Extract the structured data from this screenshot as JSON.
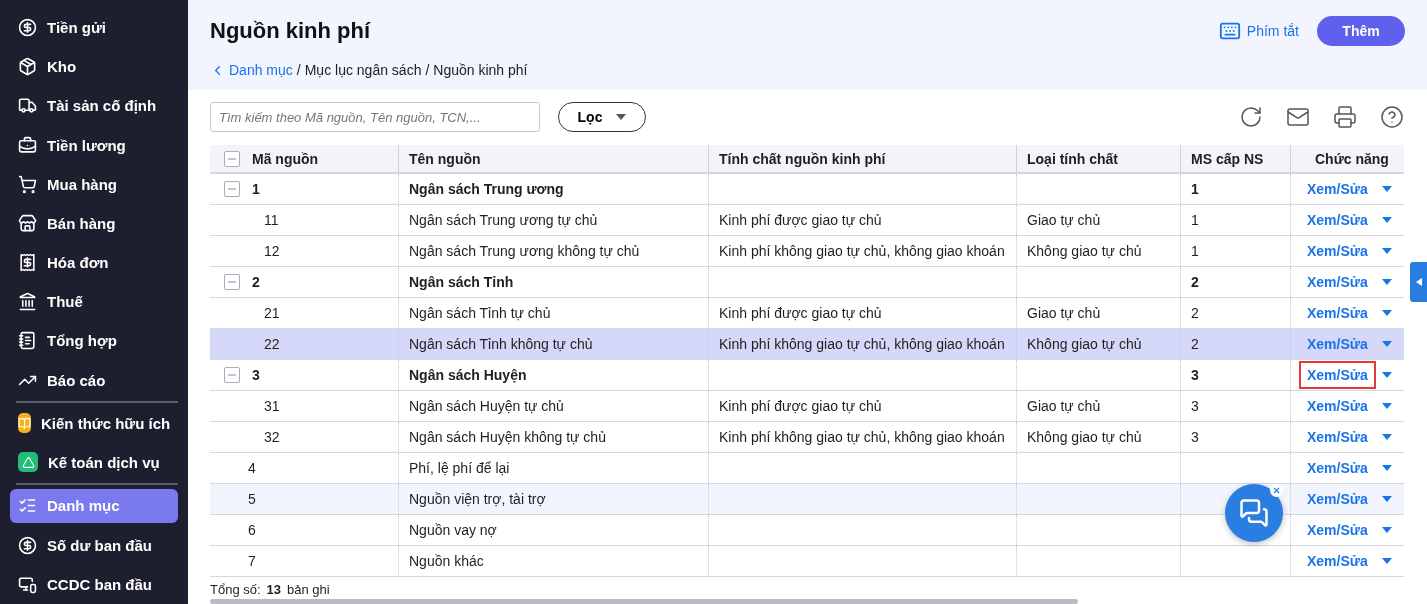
{
  "sidebar": {
    "groups": [
      [
        {
          "label": "Tiền gửi",
          "selected": false
        },
        {
          "label": "Kho",
          "selected": false
        },
        {
          "label": "Tài sản cố định",
          "selected": false
        },
        {
          "label": "Tiền lương",
          "selected": false
        },
        {
          "label": "Mua hàng",
          "selected": false
        },
        {
          "label": "Bán hàng",
          "selected": false
        },
        {
          "label": "Hóa đơn",
          "selected": false
        },
        {
          "label": "Thuế",
          "selected": false
        },
        {
          "label": "Tổng hợp",
          "selected": false
        },
        {
          "label": "Báo cáo",
          "selected": false
        }
      ],
      [
        {
          "label": "Kiến thức hữu ích",
          "selected": false,
          "color": "#f5b31b"
        },
        {
          "label": "Kế toán dịch vụ",
          "selected": false,
          "color": "#1fbf7a"
        }
      ],
      [
        {
          "label": "Danh mục",
          "selected": true
        },
        {
          "label": "Số dư ban đầu",
          "selected": false
        },
        {
          "label": "CCDC ban đầu",
          "selected": false
        }
      ]
    ]
  },
  "header": {
    "title": "Nguồn kinh phí",
    "breadcrumb": [
      {
        "kind": "link",
        "label": "Danh mục"
      },
      {
        "kind": "separator",
        "label": "/"
      },
      {
        "kind": "text",
        "label": "Mục lục ngân sách"
      },
      {
        "kind": "separator",
        "label": "/"
      },
      {
        "kind": "text",
        "label": "Nguồn kinh phí"
      }
    ],
    "shortcut": "Phím tắt",
    "add_button": "Thêm"
  },
  "toolbar": {
    "search": {
      "placeholder": "Tìm kiếm theo Mã nguồn, Tên nguồn, TCN,..."
    },
    "filter": "Lọc"
  },
  "table": {
    "expand_all": true,
    "columns": [
      "Mã nguồn",
      "Tên nguồn",
      "Tính chất nguồn kinh phí",
      "Loại tính chất",
      "MS cấp NS",
      "Chức năng"
    ],
    "rows": [
      {
        "kind": "group",
        "expanded": true,
        "selected": false,
        "hovered": false,
        "outlined": false,
        "cells": [
          "1",
          "Ngân sách Trung ương",
          "",
          "",
          "1"
        ],
        "action": "Xem/Sửa"
      },
      {
        "kind": "child",
        "selected": false,
        "hovered": false,
        "outlined": false,
        "cells": [
          "11",
          "Ngân sách Trung ương tự chủ",
          "Kinh phí được giao tự chủ",
          "Giao tự chủ",
          "1"
        ],
        "action": "Xem/Sửa"
      },
      {
        "kind": "child",
        "selected": false,
        "hovered": false,
        "outlined": false,
        "cells": [
          "12",
          "Ngân sách Trung ương không tự chủ",
          "Kinh phí không giao tự chủ, không giao khoán",
          "Không giao tự chủ",
          "1"
        ],
        "action": "Xem/Sửa"
      },
      {
        "kind": "group",
        "expanded": true,
        "selected": false,
        "hovered": false,
        "outlined": false,
        "cells": [
          "2",
          "Ngân sách Tỉnh",
          "",
          "",
          "2"
        ],
        "action": "Xem/Sửa"
      },
      {
        "kind": "child",
        "selected": false,
        "hovered": false,
        "outlined": false,
        "cells": [
          "21",
          "Ngân sách Tỉnh tự chủ",
          "Kinh phí được giao tự chủ",
          "Giao tự chủ",
          "2"
        ],
        "action": "Xem/Sửa"
      },
      {
        "kind": "child",
        "selected": true,
        "hovered": false,
        "outlined": false,
        "cells": [
          "22",
          "Ngân sách Tỉnh không tự chủ",
          "Kinh phí không giao tự chủ, không giao khoán",
          "Không giao tự chủ",
          "2"
        ],
        "action": "Xem/Sửa"
      },
      {
        "kind": "group",
        "expanded": true,
        "selected": false,
        "hovered": false,
        "outlined": true,
        "cells": [
          "3",
          "Ngân sách Huyện",
          "",
          "",
          "3"
        ],
        "action": "Xem/Sửa"
      },
      {
        "kind": "child",
        "selected": false,
        "hovered": false,
        "outlined": false,
        "cells": [
          "31",
          "Ngân sách Huyện tự chủ",
          "Kinh phí được giao tự chủ",
          "Giao tự chủ",
          "3"
        ],
        "action": "Xem/Sửa"
      },
      {
        "kind": "child",
        "selected": false,
        "hovered": false,
        "outlined": false,
        "cells": [
          "32",
          "Ngân sách Huyện không tự chủ",
          "Kinh phí không giao tự chủ, không giao khoán",
          "Không giao tự chủ",
          "3"
        ],
        "action": "Xem/Sửa"
      },
      {
        "kind": "leaf",
        "selected": false,
        "hovered": false,
        "outlined": false,
        "cells": [
          "4",
          "Phí, lệ phí để lại",
          "",
          "",
          ""
        ],
        "action": "Xem/Sửa"
      },
      {
        "kind": "leaf",
        "selected": false,
        "hovered": true,
        "outlined": false,
        "cells": [
          "5",
          "Nguồn viện trợ, tài trợ",
          "",
          "",
          ""
        ],
        "action": "Xem/Sửa"
      },
      {
        "kind": "leaf",
        "selected": false,
        "hovered": false,
        "outlined": false,
        "cells": [
          "6",
          "Nguồn vay nợ",
          "",
          "",
          ""
        ],
        "action": "Xem/Sửa"
      },
      {
        "kind": "leaf",
        "selected": false,
        "hovered": false,
        "outlined": false,
        "cells": [
          "7",
          "Nguồn khác",
          "",
          "",
          ""
        ],
        "action": "Xem/Sửa"
      }
    ]
  },
  "footer": {
    "total_label": "Tổng số:",
    "total_count": "13",
    "total_unit": "bản ghi"
  }
}
